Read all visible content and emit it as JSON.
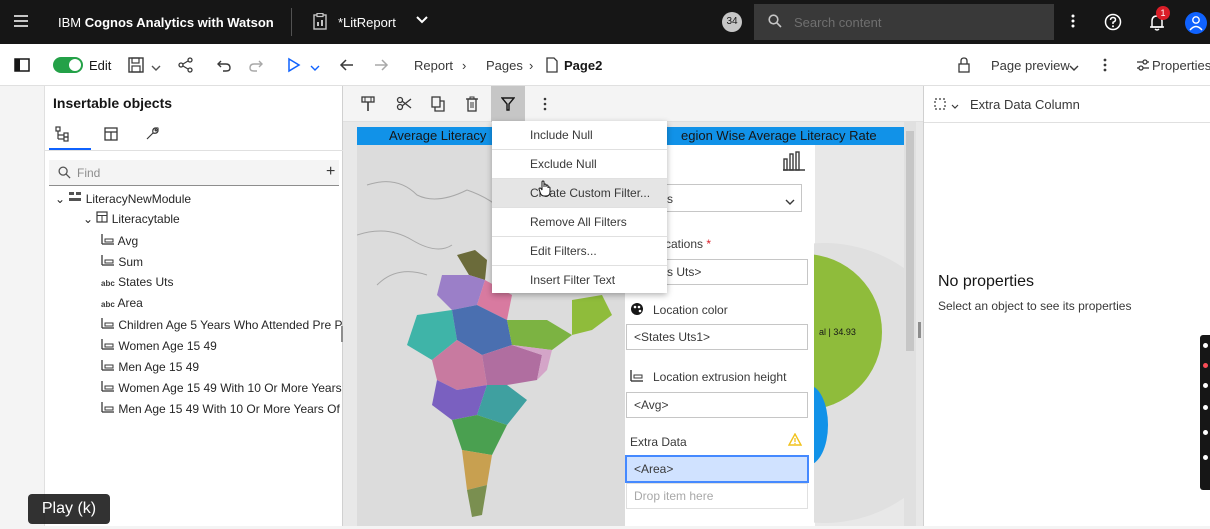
{
  "topbar": {
    "app_title_prefix": "IBM ",
    "app_title_bold": "Cognos Analytics with Watson",
    "report_name": "*LitReport",
    "badge_count": "34",
    "search_placeholder": "Search content",
    "notification_count": "1"
  },
  "toolbar": {
    "edit_label": "Edit",
    "breadcrumb": [
      "Report",
      "Pages",
      "Page2"
    ],
    "page_preview_label": "Page preview",
    "properties_label": "Properties"
  },
  "left_panel": {
    "title": "Insertable objects",
    "find_placeholder": "Find",
    "tree": [
      {
        "label": "LiteracyNewModule",
        "icon": "module-icon"
      },
      {
        "label": "Literacytable",
        "icon": "table-icon"
      },
      {
        "label": "Avg",
        "icon": "measure-icon"
      },
      {
        "label": "Sum",
        "icon": "measure-icon"
      },
      {
        "label": "States Uts",
        "icon": "abc-icon"
      },
      {
        "label": "Area",
        "icon": "abc-icon"
      },
      {
        "label": "Children Age 5 Years Who Attended Pre P",
        "icon": "measure-icon"
      },
      {
        "label": "Women Age 15 49",
        "icon": "measure-icon"
      },
      {
        "label": "Men Age 15 49",
        "icon": "measure-icon"
      },
      {
        "label": "Women Age 15 49 With 10 Or More Years",
        "icon": "measure-icon"
      },
      {
        "label": "Men Age 15 49 With 10 Or More Years Of",
        "icon": "measure-icon"
      }
    ]
  },
  "canvas": {
    "title_left": "Average Literacy",
    "title_right": "egion Wise Average Literacy Rate",
    "dropdown_value": "s",
    "locations_label": "cations",
    "locations_value": "s Uts>",
    "location_color_label": "Location color",
    "location_color_value": "<States Uts1>",
    "extrusion_label": "Location extrusion height",
    "extrusion_value": "<Avg>",
    "extra_data_label": "Extra Data",
    "extra_data_value": "<Area>",
    "drop_placeholder": "Drop item here",
    "pie_label": "al | 34.93"
  },
  "filter_menu": {
    "items": [
      "Include Null",
      "Exclude Null",
      "Create Custom Filter...",
      "Remove All Filters",
      "Edit Filters...",
      "Insert Filter Text"
    ],
    "hovered_item_text": "ate Custom Filter..."
  },
  "right_panel": {
    "header": "Extra Data Column",
    "no_props_title": "No properties",
    "no_props_sub": "Select an object to see its properties"
  },
  "video": {
    "play_label": "Play (k)"
  },
  "colors": {
    "topbar_bg": "#161616",
    "accent_blue": "#0f62fe",
    "toggle_green": "#24a148",
    "chart_title_bg": "#1192e8",
    "selected_field_bg": "#d0e2ff",
    "pie_green": "#8fbc3b",
    "pie_blue": "#1192e8"
  }
}
